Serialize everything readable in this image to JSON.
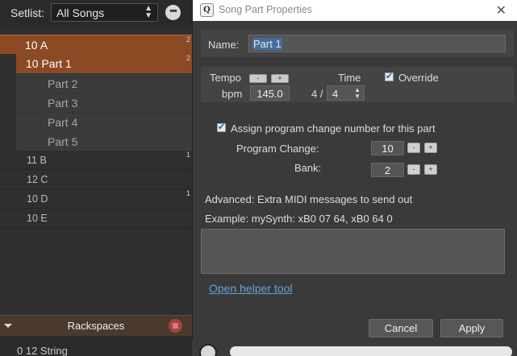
{
  "setlist": {
    "label": "Setlist:",
    "selected": "All Songs",
    "more_icon": "ellipsis-icon",
    "more_glyph": "•••"
  },
  "songs": {
    "active_song": {
      "label": "10 A",
      "badge": "2"
    },
    "parts": [
      {
        "label": "10  Part 1",
        "badge": "2"
      },
      {
        "label": "Part 2"
      },
      {
        "label": "Part 3"
      },
      {
        "label": "Part 4"
      },
      {
        "label": "Part 5"
      }
    ],
    "others": [
      {
        "label": "11 B",
        "badge": "1"
      },
      {
        "label": "12 C",
        "badge": ""
      },
      {
        "label": "10 D",
        "badge": "1"
      },
      {
        "label": "10 E",
        "badge": ""
      }
    ]
  },
  "rackspaces": {
    "label": "Rackspaces",
    "item": "0  12 String"
  },
  "dialog": {
    "title": "Song Part Properties",
    "app_icon_glyph": "Q",
    "close_glyph": "✕",
    "name_label": "Name:",
    "name_value": "Part 1",
    "tempo_label": "Tempo",
    "tempo_minus": "-",
    "tempo_plus": "+",
    "bpm_label": "bpm",
    "bpm_value": "145.0",
    "time_label": "Time",
    "time_numerator": "4 /",
    "time_denominator": "4",
    "override_label": "Override",
    "override_checked": true,
    "assign_label": "Assign program change number for this part",
    "assign_checked": true,
    "program_change_label": "Program Change:",
    "program_change_value": "10",
    "bank_label": "Bank:",
    "bank_value": "2",
    "step_minus": "-",
    "step_plus": "+",
    "advanced_label": "Advanced: Extra MIDI messages to send out",
    "example_label": "Example: mySynth: xB0 07 64, xB0 64 0",
    "midi_text": "",
    "helper_link": "Open helper tool",
    "cancel_label": "Cancel",
    "apply_label": "Apply"
  },
  "colors": {
    "selected_row": "#8b4a23",
    "accent_link": "#6e9fd0",
    "rackspace_bar": "#4a3a2d"
  }
}
